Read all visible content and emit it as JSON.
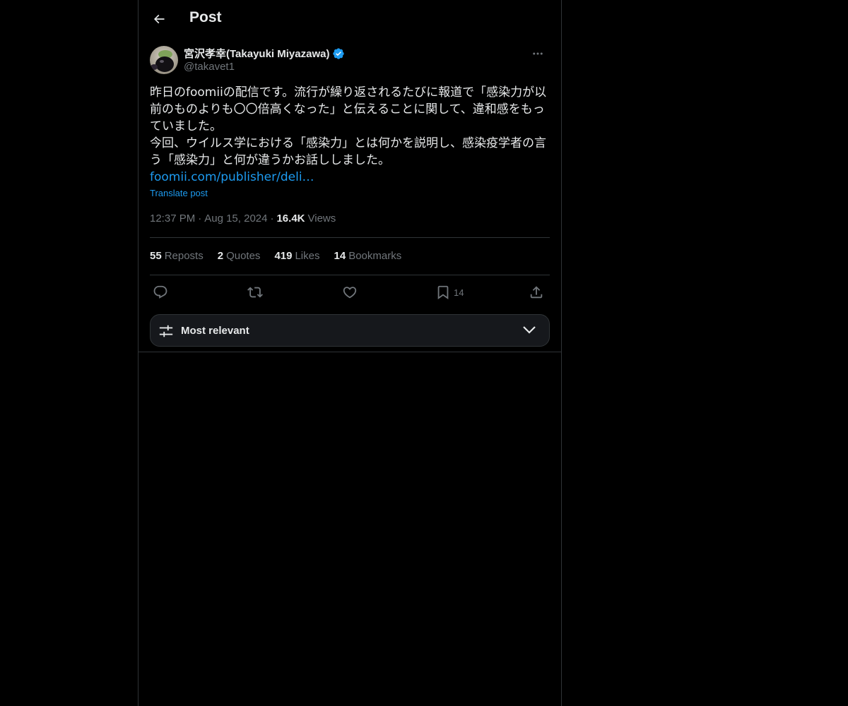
{
  "header": {
    "title": "Post",
    "back_icon": "arrow-left-icon"
  },
  "author": {
    "name": "宮沢孝幸(Takayuki Miyazawa)",
    "handle": "@takavet1",
    "verified": true,
    "verified_color": "#1d9bf0"
  },
  "post": {
    "text": "昨日のfoomiiの配信です。流行が繰り返されるたびに報道で「感染力が以前のものよりも〇〇倍高くなった」と伝えることに関して、違和感をもっていました。\n今回、ウイルス学における「感染力」とは何かを説明し、感染疫学者の言う「感染力」と何が違うかお話ししました。",
    "link": "foomii.com/publisher/deli…",
    "translate_label": "Translate post",
    "time": "12:37 PM",
    "separator": "·",
    "date": "Aug 15, 2024",
    "views_count": "16.4K",
    "views_label": "Views"
  },
  "stats": [
    {
      "count": "55",
      "label": "Reposts"
    },
    {
      "count": "2",
      "label": "Quotes"
    },
    {
      "count": "419",
      "label": "Likes"
    },
    {
      "count": "14",
      "label": "Bookmarks"
    }
  ],
  "actions": {
    "reply_icon": "reply-icon",
    "repost_icon": "repost-icon",
    "like_icon": "heart-icon",
    "bookmark_icon": "bookmark-icon",
    "bookmark_count": "14",
    "share_icon": "share-icon"
  },
  "sort": {
    "label": "Most relevant",
    "icon": "sliders-icon",
    "chevron": "chevron-down-icon"
  },
  "colors": {
    "background": "#000000",
    "text": "#e7e9ea",
    "muted": "#71767b",
    "accent": "#1d9bf0",
    "border": "#2f3336"
  }
}
